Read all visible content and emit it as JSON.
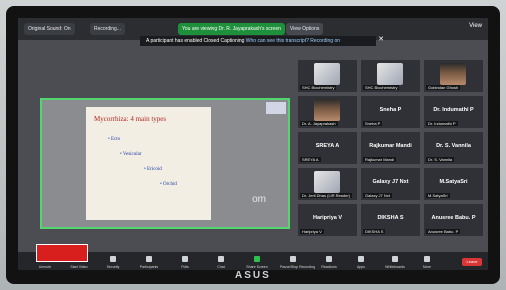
{
  "topbar": {
    "original_sound": "Original Sound: On",
    "recording": "Recording...",
    "viewing_notice": "You are viewing Dr. R. Jayaprakash's screen",
    "view_options": "View Options",
    "view": "View"
  },
  "banner": {
    "text": "A participant has enabled Closed Captioning",
    "link": "Who can see this transcript? Recording on"
  },
  "slide": {
    "title": "Mycorrhiza: 4 main types",
    "bullets": [
      "Ecto",
      "Vesicular",
      "Ericoid",
      "Orchid"
    ],
    "corner_text": "om"
  },
  "participants": [
    {
      "name": "",
      "tag": "SHC Biochemistry"
    },
    {
      "name": "",
      "tag": "SHC Biochemistry"
    },
    {
      "name": "",
      "tag": "Gobindan Ghosh"
    },
    {
      "name": "",
      "tag": "Dr. A. Jayaprakash"
    },
    {
      "name": "Sneha P",
      "tag": "Sneha P"
    },
    {
      "name": "Dr. Indumathi P",
      "tag": "Dr. Indumathi P"
    },
    {
      "name": "SREYA A",
      "tag": "SREYA A"
    },
    {
      "name": "Rajkumar Mandi",
      "tag": "Rajkumar Mandi"
    },
    {
      "name": "Dr. S. Vannila",
      "tag": "Dr. S. Vannila"
    },
    {
      "name": "",
      "tag": "Dr. Jeril Dhas (LiR Reader)"
    },
    {
      "name": "Galaxy J7 Nxt",
      "tag": "Galaxy J7 Nxt"
    },
    {
      "name": "M.SatyaSri",
      "tag": "M.SatyaSri"
    },
    {
      "name": "Haripriya V",
      "tag": "Haripriya V"
    },
    {
      "name": "DIKSHA S",
      "tag": "DIKSHA S"
    },
    {
      "name": "Anusree Babu. P",
      "tag": "Anusree Babu. P"
    }
  ],
  "toolbar": {
    "items": [
      "Unmute",
      "Start Video",
      "Security",
      "Participants",
      "Polls",
      "Chat",
      "Share Screen",
      "Pause/Stop Recording",
      "Reactions",
      "Apps",
      "Whiteboards",
      "More"
    ],
    "leave": "Leave"
  },
  "laptop": {
    "brand": "ASUS"
  },
  "colors": {
    "accent_green": "#1e8f3a",
    "slide_border": "#53d66d",
    "leave_red": "#d93636"
  }
}
